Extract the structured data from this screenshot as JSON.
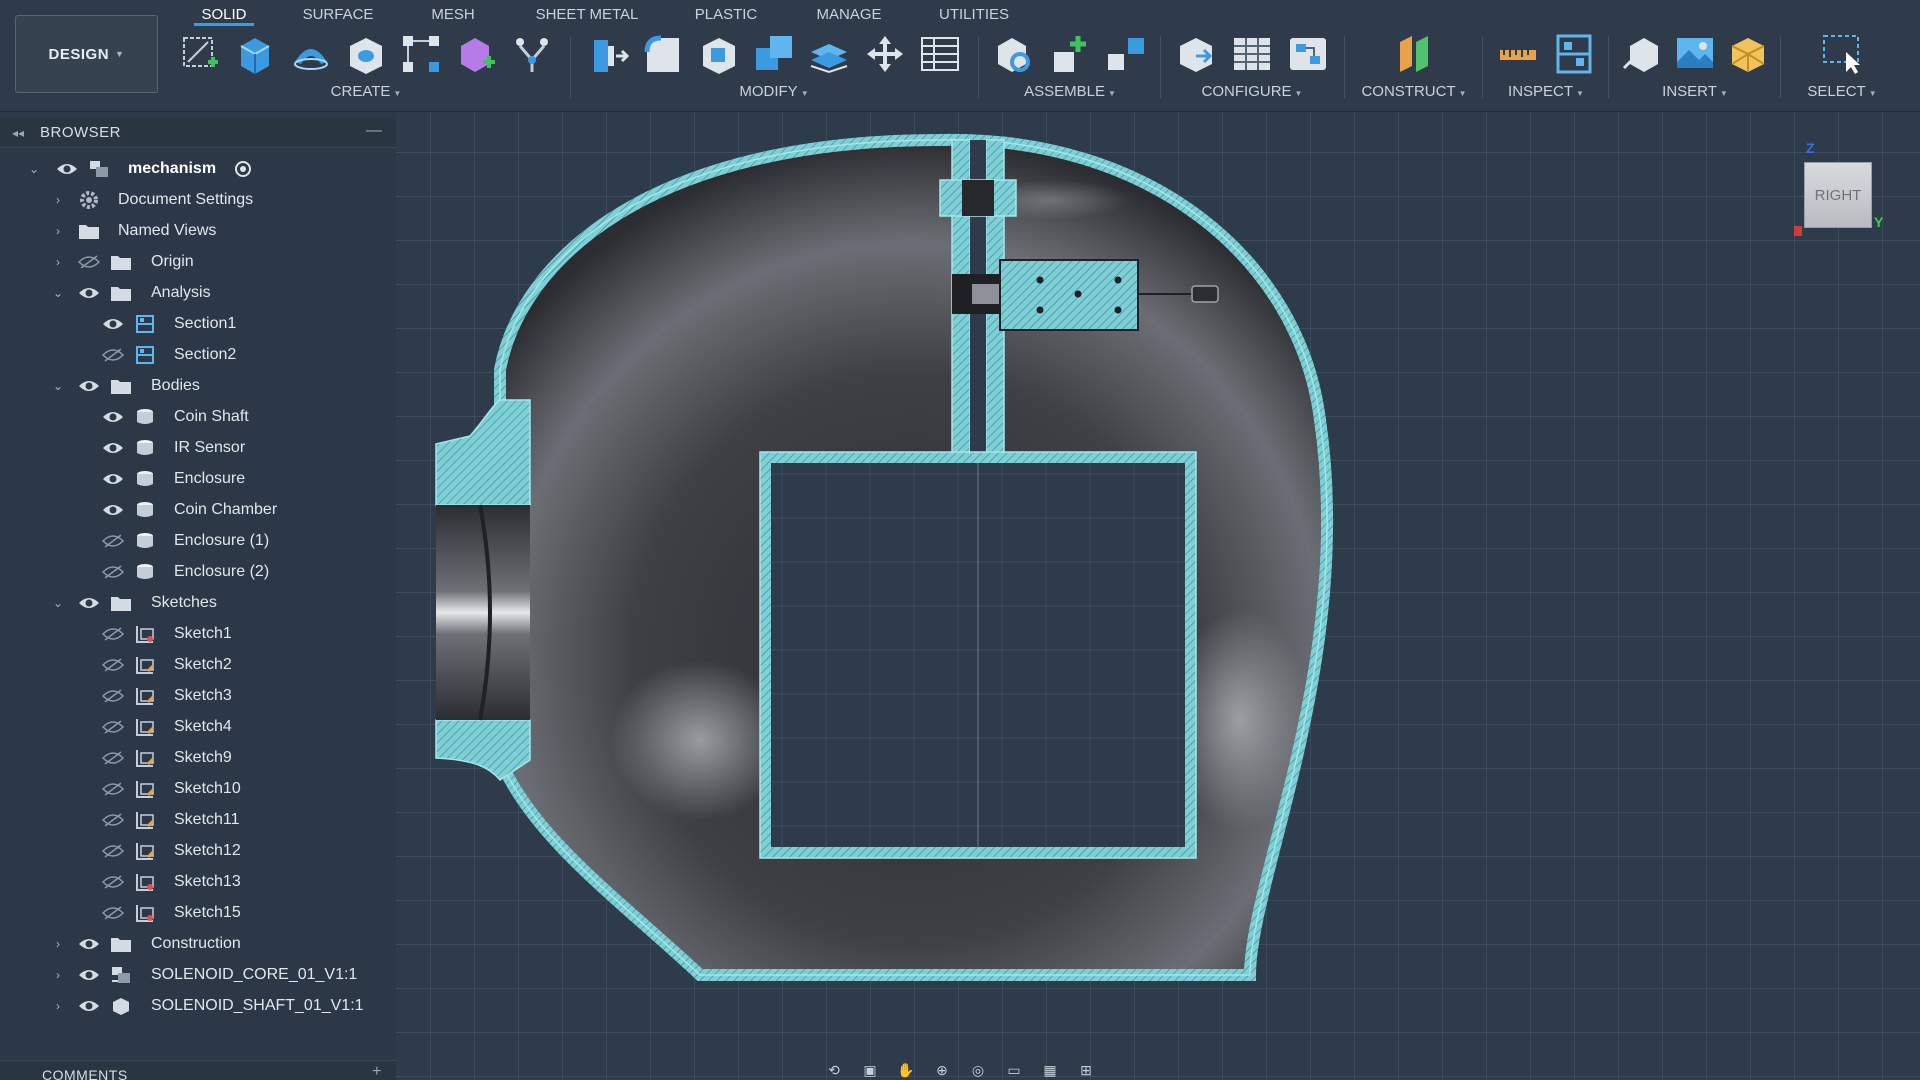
{
  "workspace": {
    "label": "DESIGN"
  },
  "tabs": [
    {
      "label": "SOLID",
      "active": true
    },
    {
      "label": "SURFACE",
      "active": false
    },
    {
      "label": "MESH",
      "active": false
    },
    {
      "label": "SHEET METAL",
      "active": false
    },
    {
      "label": "PLASTIC",
      "active": false
    },
    {
      "label": "MANAGE",
      "active": false
    },
    {
      "label": "UTILITIES",
      "active": false
    }
  ],
  "tool_groups": {
    "create": "CREATE",
    "modify": "MODIFY",
    "assemble": "ASSEMBLE",
    "configure": "CONFIGURE",
    "construct": "CONSTRUCT",
    "inspect": "INSPECT",
    "insert": "INSERT",
    "select": "SELECT"
  },
  "browser": {
    "title": "BROWSER",
    "root": "mechanism",
    "items": {
      "document_settings": "Document Settings",
      "named_views": "Named Views",
      "origin": "Origin",
      "analysis": "Analysis",
      "section1": "Section1",
      "section2": "Section2",
      "bodies": "Bodies",
      "coin_shaft": "Coin Shaft",
      "ir_sensor": "IR Sensor",
      "enclosure": "Enclosure",
      "coin_chamber": "Coin Chamber",
      "enclosure_1": "Enclosure (1)",
      "enclosure_2": "Enclosure (2)",
      "sketches": "Sketches",
      "sketch1": "Sketch1",
      "sketch2": "Sketch2",
      "sketch3": "Sketch3",
      "sketch4": "Sketch4",
      "sketch9": "Sketch9",
      "sketch10": "Sketch10",
      "sketch11": "Sketch11",
      "sketch12": "Sketch12",
      "sketch13": "Sketch13",
      "sketch15": "Sketch15",
      "construction": "Construction",
      "solenoid_core": "SOLENOID_CORE_01_V1:1",
      "solenoid_shaft": "SOLENOID_SHAFT_01_V1:1"
    }
  },
  "comments": {
    "title": "COMMENTS"
  },
  "viewcube": {
    "face": "RIGHT",
    "axis_z": "Z",
    "axis_y": "Y"
  },
  "colors": {
    "section_fill": "#7fd0d6",
    "body_dark": "#3a3c40",
    "accent": "#2ba3e8"
  }
}
